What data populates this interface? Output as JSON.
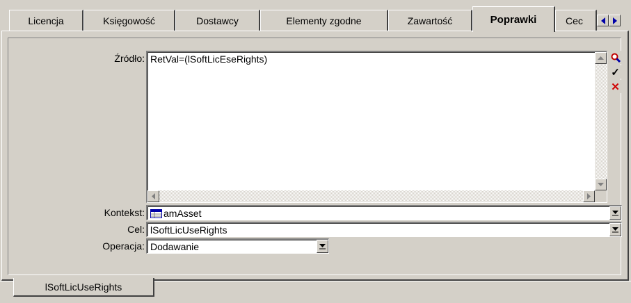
{
  "tabs": [
    {
      "label": "Licencja",
      "active": false
    },
    {
      "label": "Księgowość",
      "active": false
    },
    {
      "label": "Dostawcy",
      "active": false
    },
    {
      "label": "Elementy zgodne",
      "active": false
    },
    {
      "label": "Zawartość",
      "active": false
    },
    {
      "label": "Poprawki",
      "active": true
    },
    {
      "label": "Cec",
      "active": false
    }
  ],
  "form": {
    "source_label": "Źródło:",
    "source_value": "RetVal=(lSoftLicEseRights)",
    "context_label": "Kontekst:",
    "context_value": "amAsset",
    "target_label": "Cel:",
    "target_value": "lSoftLicUseRights",
    "operation_label": "Operacja:",
    "operation_value": "Dodawanie"
  },
  "side_buttons": [
    {
      "icon": "magnifier-icon",
      "symbol": "🔍"
    },
    {
      "icon": "check-icon",
      "symbol": "✓"
    },
    {
      "icon": "cross-icon",
      "symbol": "✕"
    }
  ],
  "bottom_tab": {
    "label": "lSoftLicUseRights"
  },
  "colors": {
    "face": "#d4d0c8",
    "highlight": "#ffffff",
    "shadow": "#404040",
    "accent_blue": "#0000a8",
    "cross_red": "#d00000"
  }
}
